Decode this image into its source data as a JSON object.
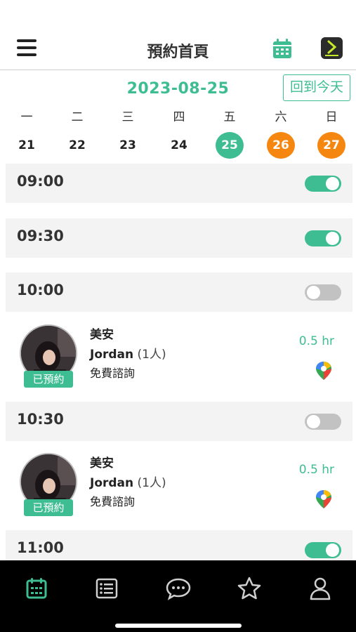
{
  "header": {
    "title": "預約首頁"
  },
  "date_nav": {
    "current_date": "2023-08-25",
    "today_button": "回到今天"
  },
  "week": {
    "weekdays": [
      "一",
      "二",
      "三",
      "四",
      "五",
      "六",
      "日"
    ],
    "days": [
      "21",
      "22",
      "23",
      "24",
      "25",
      "26",
      "27"
    ]
  },
  "slots": [
    {
      "time": "09:00",
      "enabled": true
    },
    {
      "time": "09:30",
      "enabled": true
    },
    {
      "time": "10:00",
      "enabled": false
    },
    {
      "time": "10:30",
      "enabled": false
    },
    {
      "time": "11:00",
      "enabled": true
    }
  ],
  "bookings": [
    {
      "name": "美安",
      "client": "Jordan",
      "count": "(1人)",
      "service": "免費諮詢",
      "duration": "0.5 hr",
      "status": "已預約"
    },
    {
      "name": "美安",
      "client": "Jordan",
      "count": "(1人)",
      "service": "免費諮詢",
      "duration": "0.5 hr",
      "status": "已預約"
    }
  ],
  "colors": {
    "accent": "#3ebd93",
    "weekend": "#f5860f",
    "toggle_off": "#c2c2c2",
    "tabbar": "#000000"
  },
  "icons": [
    "menu-icon",
    "calendar-icon",
    "app-logo",
    "map-pin-icon",
    "tab-calendar-icon",
    "tab-list-icon",
    "tab-chat-icon",
    "tab-star-icon",
    "tab-profile-icon"
  ]
}
